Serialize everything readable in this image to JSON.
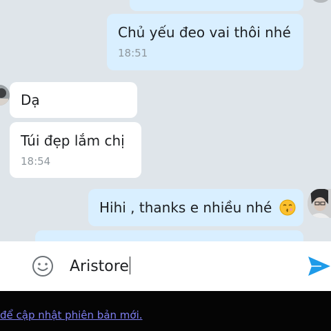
{
  "messages": [
    {
      "direction": "outgoing",
      "text": "",
      "time": ""
    },
    {
      "direction": "outgoing",
      "text": "Chủ yếu đeo vai thôi nhé",
      "time": "18:51"
    },
    {
      "direction": "incoming",
      "text": "Dạ",
      "time": ""
    },
    {
      "direction": "incoming",
      "text": "Túi đẹp lắm chị",
      "time": "18:54"
    },
    {
      "direction": "outgoing",
      "text": "Hihi , thanks e nhiều nhé",
      "time": "",
      "emoji": "kissing-face-emoji"
    },
    {
      "direction": "outgoing",
      "text": "",
      "time": ""
    }
  ],
  "composer": {
    "value": "Aristore",
    "emoji_icon": "smiley-icon",
    "send_icon": "send-icon"
  },
  "footer": {
    "link_text": "để cập nhật phiên bản mới."
  },
  "colors": {
    "outgoing_bubble": "#d9efff",
    "incoming_bubble": "#ffffff",
    "chat_background": "#dfe5ea",
    "send_icon": "#1e9be9",
    "link": "#7f7ff2"
  }
}
